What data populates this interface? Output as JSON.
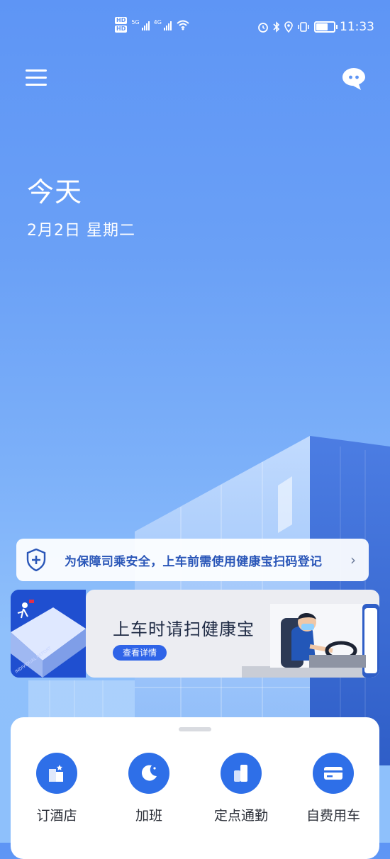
{
  "status_bar": {
    "time": "11:33",
    "signal_1_label": "5G",
    "signal_2_label": "4G",
    "hd_1": "HD",
    "hd_2": "HD"
  },
  "header": {
    "menu_icon": "hamburger-menu-icon",
    "chat_icon": "chat-bubble-icon"
  },
  "date": {
    "title": "今天",
    "subtitle": "2月2日 星期二"
  },
  "notice": {
    "text": "为保障司乘安全，上车前需使用健康宝扫码登记",
    "icon": "shield-plus-icon"
  },
  "banner": {
    "title": "上车时请扫健康宝",
    "button_label": "查看详情",
    "side_caption": "INDIVIDUAL REPORT"
  },
  "services": [
    {
      "label": "订酒店",
      "icon": "hotel-icon"
    },
    {
      "label": "加班",
      "icon": "moon-icon"
    },
    {
      "label": "定点通勤",
      "icon": "commute-icon"
    },
    {
      "label": "自费用车",
      "icon": "card-icon"
    }
  ],
  "colors": {
    "accent": "#2e6fe8",
    "background_top": "#5e95f5",
    "notice_text": "#2a56b8"
  }
}
